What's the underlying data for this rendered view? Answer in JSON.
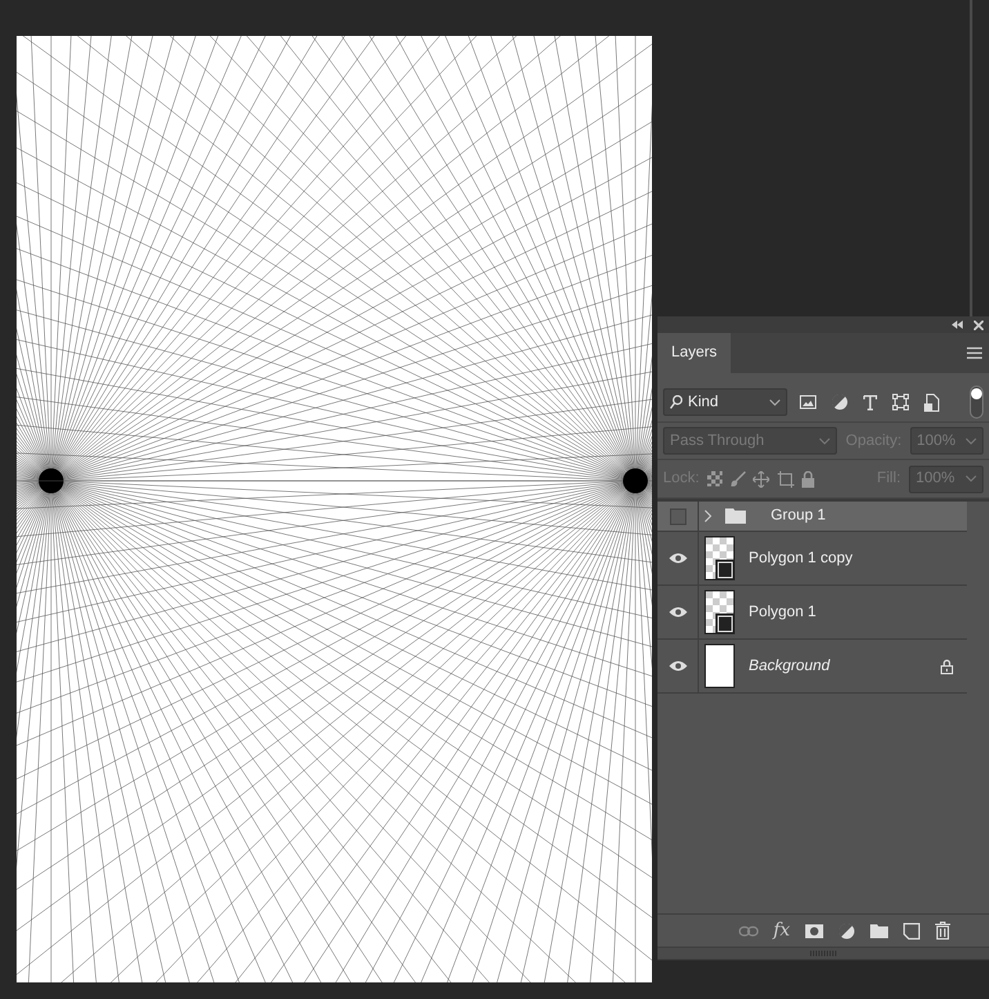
{
  "panel": {
    "tabs": [
      {
        "label": "Layers",
        "selected": true
      }
    ],
    "filter": {
      "value": "Kind",
      "on": true
    },
    "blend_mode": {
      "value": "Pass Through",
      "disabled": true
    },
    "opacity": {
      "label": "Opacity:",
      "value": "100%",
      "disabled": true
    },
    "lock": {
      "label": "Lock:"
    },
    "fill": {
      "label": "Fill:",
      "value": "100%",
      "disabled": true
    },
    "effects_button": "fx",
    "layers": [
      {
        "name": "Group 1",
        "kind": "group",
        "visible": false,
        "selected": true,
        "locked": false
      },
      {
        "name": "Polygon 1 copy",
        "kind": "shape",
        "visible": true,
        "selected": false,
        "locked": false
      },
      {
        "name": "Polygon 1",
        "kind": "shape",
        "visible": true,
        "selected": false,
        "locked": false
      },
      {
        "name": "Background",
        "kind": "background",
        "visible": true,
        "selected": false,
        "locked": true
      }
    ]
  }
}
